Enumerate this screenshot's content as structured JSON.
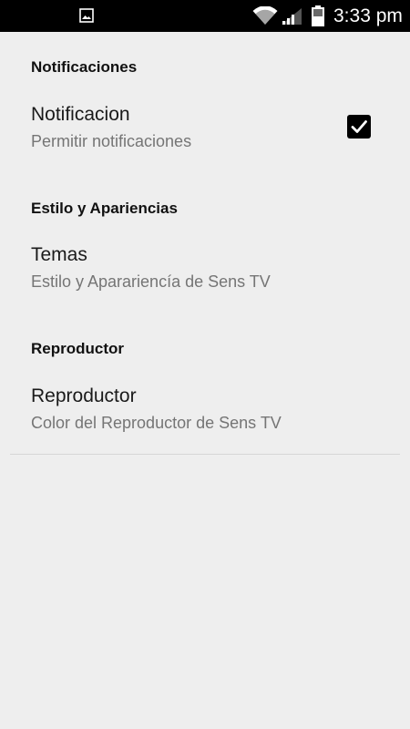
{
  "status_bar": {
    "time": "3:33 pm",
    "icons": {
      "left": "image-icon",
      "wifi": "wifi-icon",
      "signal": "signal-icon",
      "battery": "battery-icon"
    }
  },
  "settings": {
    "sections": [
      {
        "header": "Notificaciones",
        "item": {
          "title": "Notificacion",
          "summary": "Permitir notificaciones",
          "checked": true
        }
      },
      {
        "header": "Estilo y Apariencias",
        "item": {
          "title": "Temas",
          "summary": "Estilo y Aparariencía de Sens TV"
        }
      },
      {
        "header": "Reproductor",
        "item": {
          "title": "Reproductor",
          "summary": "Color del Reproductor de Sens TV"
        }
      }
    ]
  },
  "colors": {
    "background": "#eeeeee",
    "status_bar": "#000000",
    "header_text": "#111111",
    "summary_text": "#757575",
    "checkbox": "#000000"
  }
}
